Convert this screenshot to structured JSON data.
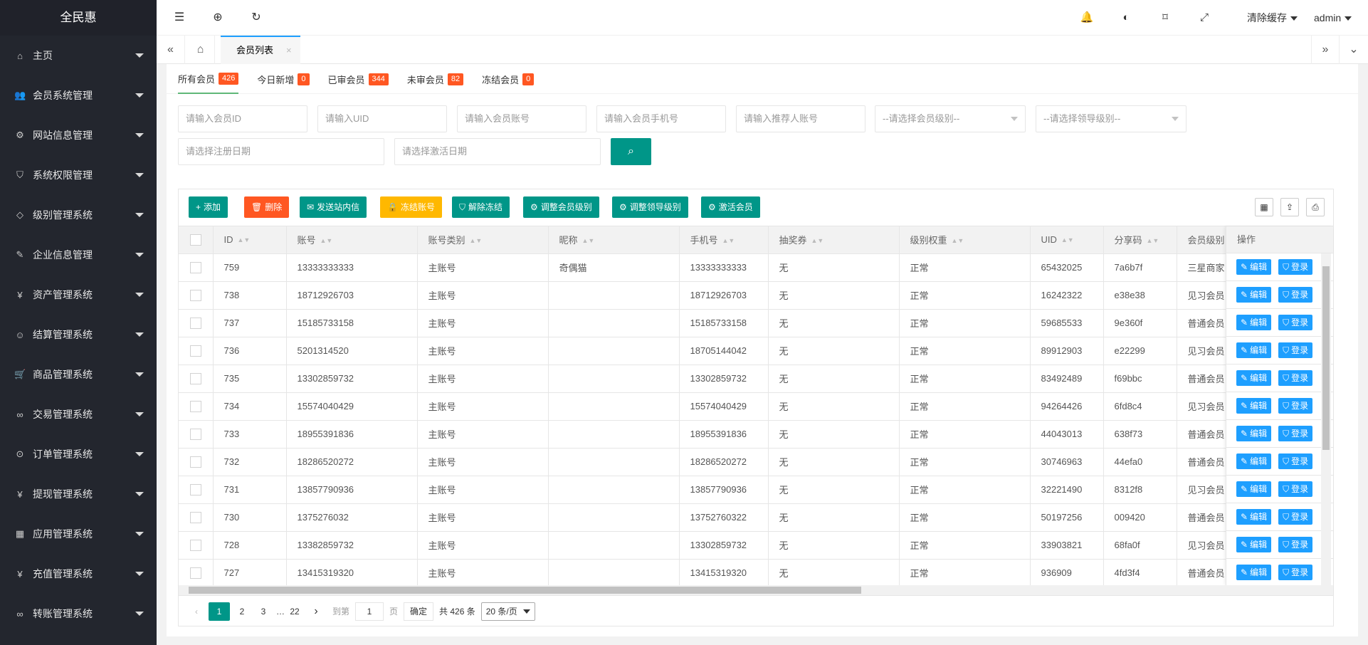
{
  "sidebar": {
    "logo": "全民惠",
    "items": [
      {
        "label": "主页",
        "icon": "⌂"
      },
      {
        "label": "会员系统管理",
        "icon": "👥"
      },
      {
        "label": "网站信息管理",
        "icon": "⚙"
      },
      {
        "label": "系统权限管理",
        "icon": "⛉"
      },
      {
        "label": "级别管理系统",
        "icon": "◇"
      },
      {
        "label": "企业信息管理",
        "icon": "✎"
      },
      {
        "label": "资产管理系统",
        "icon": "¥"
      },
      {
        "label": "结算管理系统",
        "icon": "☺"
      },
      {
        "label": "商品管理系统",
        "icon": "🛒"
      },
      {
        "label": "交易管理系统",
        "icon": "∞"
      },
      {
        "label": "订单管理系统",
        "icon": "⊙"
      },
      {
        "label": "提现管理系统",
        "icon": "¥"
      },
      {
        "label": "应用管理系统",
        "icon": "▦"
      },
      {
        "label": "充值管理系统",
        "icon": "¥"
      },
      {
        "label": "转账管理系统",
        "icon": "∞"
      }
    ]
  },
  "header": {
    "clear_cache": "清除缓存",
    "user": "admin"
  },
  "tabs": {
    "current": "会员列表",
    "close": "×"
  },
  "status_tabs": [
    {
      "label": "所有会员",
      "count": "426"
    },
    {
      "label": "今日新增",
      "count": "0"
    },
    {
      "label": "已审会员",
      "count": "344"
    },
    {
      "label": "未审会员",
      "count": "82"
    },
    {
      "label": "冻结会员",
      "count": "0"
    }
  ],
  "filters": {
    "member_id": "请输入会员ID",
    "uid": "请输入UID",
    "account": "请输入会员账号",
    "phone": "请输入会员手机号",
    "referrer": "请输入推荐人账号",
    "member_level": "--请选择会员级别--",
    "leader_level": "--请选择领导级别--",
    "reg_date": "请选择注册日期",
    "act_date": "请选择激活日期"
  },
  "toolbar": {
    "add": "添加",
    "delete": "删除",
    "send_msg": "发送站内信",
    "freeze": "冻结账号",
    "unfreeze": "解除冻结",
    "adjust_member_level": "调整会员级别",
    "adjust_leader_level": "调整领导级别",
    "activate": "激活会员"
  },
  "table": {
    "columns": [
      "ID",
      "账号",
      "账号类别",
      "昵称",
      "手机号",
      "抽奖券",
      "级别权重",
      "UID",
      "分享码",
      "会员级别"
    ],
    "ops_header": "操作",
    "edit_label": "编辑",
    "login_label": "登录",
    "rows": [
      [
        "759",
        "13333333333",
        "主账号",
        "奇偶猫",
        "13333333333",
        "无",
        "正常",
        "65432025",
        "7a6b7f",
        "三星商家"
      ],
      [
        "738",
        "18712926703",
        "主账号",
        "",
        "18712926703",
        "无",
        "正常",
        "16242322",
        "e38e38",
        "见习会员"
      ],
      [
        "737",
        "15185733158",
        "主账号",
        "",
        "15185733158",
        "无",
        "正常",
        "59685533",
        "9e360f",
        "普通会员"
      ],
      [
        "736",
        "5201314520",
        "主账号",
        "",
        "18705144042",
        "无",
        "正常",
        "89912903",
        "e22299",
        "见习会员"
      ],
      [
        "735",
        "13302859732",
        "主账号",
        "",
        "13302859732",
        "无",
        "正常",
        "83492489",
        "f69bbc",
        "普通会员"
      ],
      [
        "734",
        "15574040429",
        "主账号",
        "",
        "15574040429",
        "无",
        "正常",
        "94264426",
        "6fd8c4",
        "见习会员"
      ],
      [
        "733",
        "18955391836",
        "主账号",
        "",
        "18955391836",
        "无",
        "正常",
        "44043013",
        "638f73",
        "普通会员"
      ],
      [
        "732",
        "18286520272",
        "主账号",
        "",
        "18286520272",
        "无",
        "正常",
        "30746963",
        "44efa0",
        "普通会员"
      ],
      [
        "731",
        "13857790936",
        "主账号",
        "",
        "13857790936",
        "无",
        "正常",
        "32221490",
        "8312f8",
        "见习会员"
      ],
      [
        "730",
        "1375276032",
        "主账号",
        "",
        "13752760322",
        "无",
        "正常",
        "50197256",
        "009420",
        "普通会员"
      ],
      [
        "728",
        "13382859732",
        "主账号",
        "",
        "13302859732",
        "无",
        "正常",
        "33903821",
        "68fa0f",
        "见习会员"
      ],
      [
        "727",
        "13415319320",
        "主账号",
        "",
        "13415319320",
        "无",
        "正常",
        "936909",
        "4fd3f4",
        "普通会员"
      ]
    ]
  },
  "pager": {
    "prev": "‹",
    "pages": [
      "1",
      "2",
      "3"
    ],
    "ellipsis": "…",
    "last": "22",
    "next": "›",
    "goto": "到第",
    "goto_value": "1",
    "page_unit": "页",
    "confirm": "确定",
    "total": "共 426 条",
    "per_page": "20 条/页"
  },
  "colors": {
    "sidebar_bg": "#23262e",
    "teal": "#009688",
    "red": "#ff5722",
    "yellow": "#ffb800",
    "blue": "#1e9fff",
    "badge": "#ff5722"
  }
}
